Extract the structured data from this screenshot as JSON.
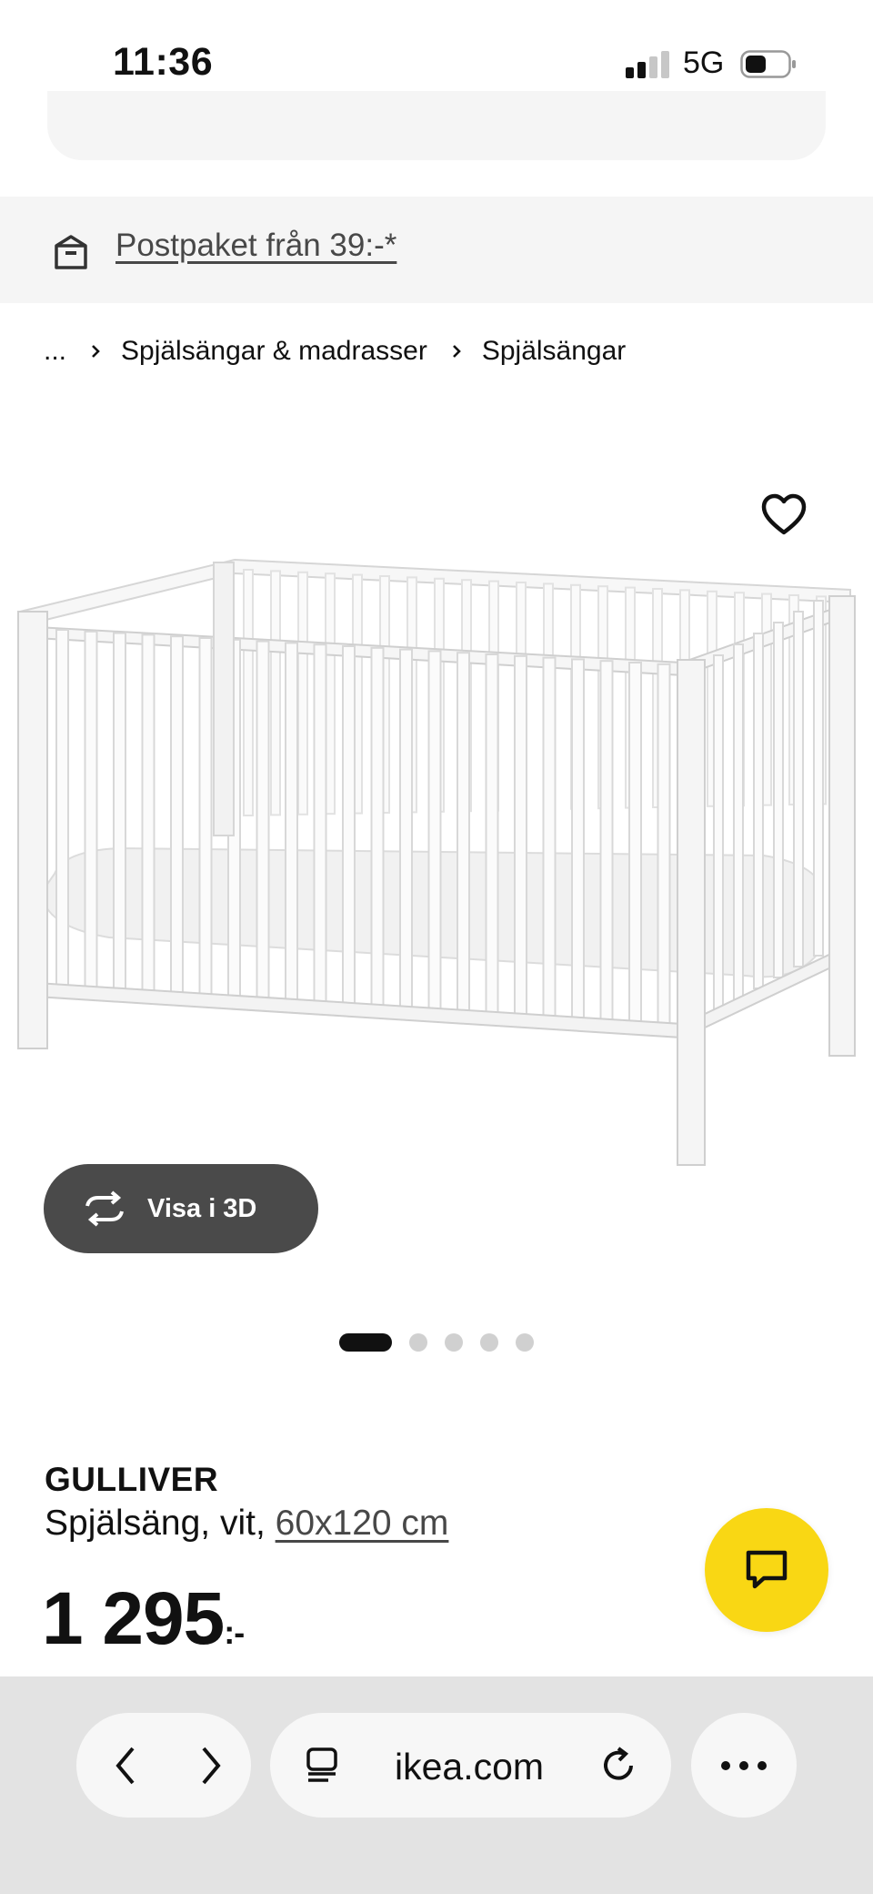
{
  "status_bar": {
    "time": "11:36",
    "network": "5G"
  },
  "banner": {
    "text": "Postpaket från 39:-*",
    "icon": "parcel-box-icon"
  },
  "breadcrumb": {
    "items": [
      "...",
      "Spjälsängar & madrasser",
      "Spjälsängar"
    ],
    "separator_icon": "chevron-right-icon"
  },
  "gallery": {
    "image_name": "crib-product-image",
    "view_3d_label": "Visa i 3D",
    "page_count": 5,
    "active_page": 1
  },
  "product": {
    "name": "GULLIVER",
    "description": "Spjälsäng, vit, ",
    "size_link": "60x120 cm",
    "price": "1 295",
    "price_suffix": ":-"
  },
  "browser": {
    "url": "ikea.com"
  },
  "colors": {
    "accent_yellow": "#f9d714",
    "view3d_bg": "#4a4a4a",
    "banner_bg": "#f5f5f5",
    "toolbar_bg": "#e3e3e3"
  }
}
